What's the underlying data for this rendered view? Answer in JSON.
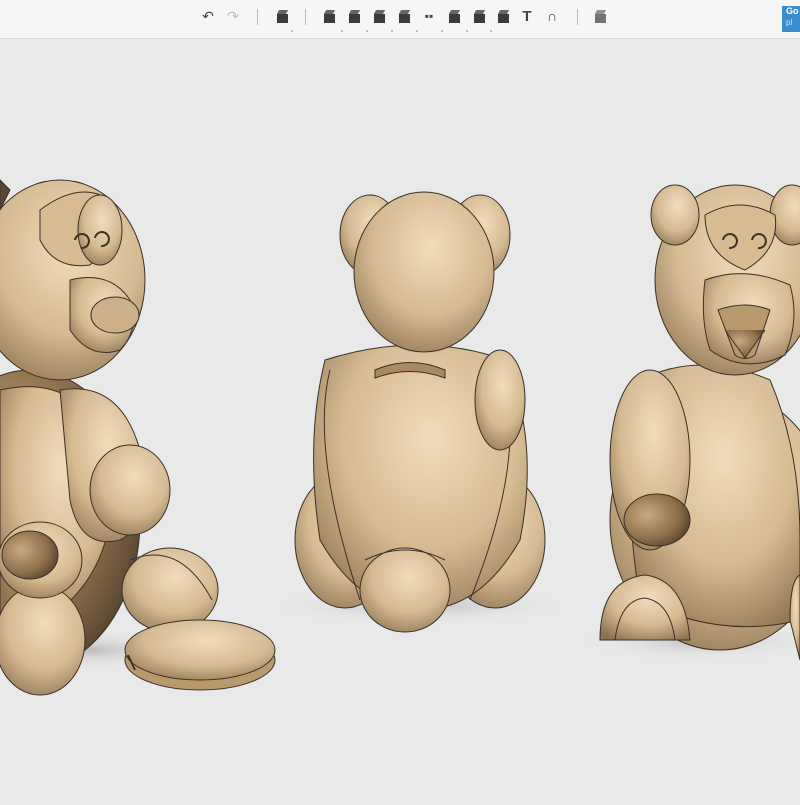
{
  "toolbar": {
    "undo_icon": "undo-icon",
    "redo_icon": "redo-icon",
    "tools": [
      "new-body-icon",
      "primitive-icon",
      "sketch-icon",
      "construct-icon",
      "modify-icon",
      "pattern-icon",
      "grouping-icon",
      "combine-icon",
      "measure-icon",
      "text-icon",
      "snap-icon",
      "material-icon"
    ],
    "get_button_label": "Go",
    "get_button_sub": "pl"
  },
  "scene": {
    "models": [
      "teddy-bear-front-left",
      "teddy-bear-back",
      "teddy-bear-front-right",
      "coin-slot-cap"
    ],
    "colors": {
      "body": "#d8bf99",
      "shade": "#8f7553",
      "outline": "#3a3126"
    }
  }
}
